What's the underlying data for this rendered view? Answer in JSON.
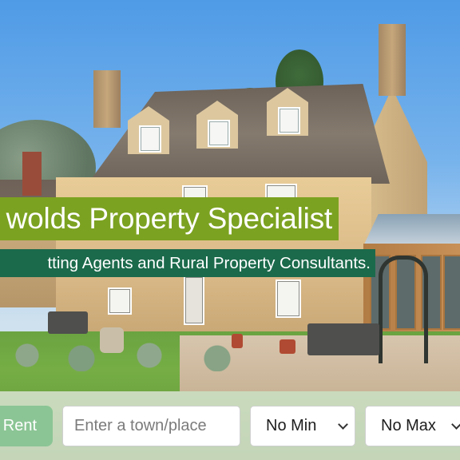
{
  "hero": {
    "headline": "wolds Property Specialist",
    "subheadline": "tting Agents and Rural Property Consultants."
  },
  "search": {
    "mode_button_label": "Rent",
    "location_placeholder": "Enter a town/place",
    "min_price_selected": "No Min",
    "max_price_selected": "No Max"
  },
  "colors": {
    "headline_bg": "#7ca221",
    "subheadline_bg": "#1b6a4c",
    "rent_button_bg": "#8bc595"
  },
  "icons": {
    "select_arrow": "chevron-down-icon"
  }
}
